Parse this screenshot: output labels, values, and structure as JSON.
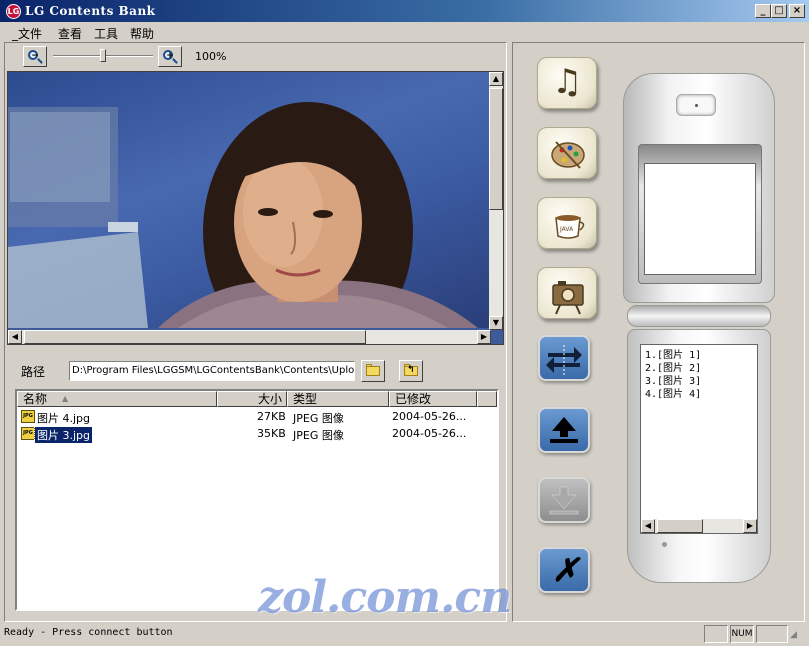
{
  "window": {
    "title": "LG Contents Bank",
    "logo_text": "LG",
    "controls": [
      "_",
      "□",
      "×"
    ]
  },
  "menu": {
    "items": [
      "_文件",
      "查看",
      "工具",
      "帮助"
    ]
  },
  "zoom": {
    "value_label": "100%",
    "zoom_out_icon": "zoom-out-icon",
    "zoom_in_icon": "zoom-in-icon",
    "out_sign": "−",
    "in_sign": "+",
    "level": 0.5
  },
  "path": {
    "label": "路径",
    "value": "D:\\Program Files\\LGGSM\\LGContentsBank\\Contents\\Upload"
  },
  "file_list": {
    "columns": [
      "名称",
      "大小",
      "类型",
      "已修改"
    ],
    "sort_indicator": "▲",
    "rows": [
      {
        "icon_text": "JPG",
        "name": "图片 4.jpg",
        "size": "27KB",
        "type": "JPEG 图像",
        "modified": "2004-05-26...",
        "selected": false
      },
      {
        "icon_text": "JPG",
        "name": "图片 3.jpg",
        "size": "35KB",
        "type": "JPEG 图像",
        "modified": "2004-05-26...",
        "selected": true
      }
    ]
  },
  "function_buttons": [
    {
      "icon": "music-note-icon",
      "glyph": "♫"
    },
    {
      "icon": "palette-icon",
      "glyph": "🎨"
    },
    {
      "icon": "java-cup-icon",
      "glyph": "JAVA"
    },
    {
      "icon": "camera-icon",
      "glyph": "📷"
    }
  ],
  "action_buttons": [
    {
      "icon": "transfer-arrows-icon",
      "glyph": "⇆"
    },
    {
      "icon": "upload-icon",
      "glyph": "⭱"
    },
    {
      "icon": "download-icon",
      "glyph": "⭳"
    },
    {
      "icon": "delete-icon",
      "glyph": "✗"
    }
  ],
  "phone": {
    "list": [
      "1.[图片 1]",
      "2.[图片 2]",
      "3.[图片 3]",
      "4.[图片 4]"
    ]
  },
  "status": {
    "text": "Ready - Press connect button",
    "num": "NUM"
  },
  "watermark": "zol.com.cn",
  "colors": {
    "selection": "#0a246a",
    "title_bar": "#0a246a",
    "action_blue": "#3a6aa8"
  }
}
